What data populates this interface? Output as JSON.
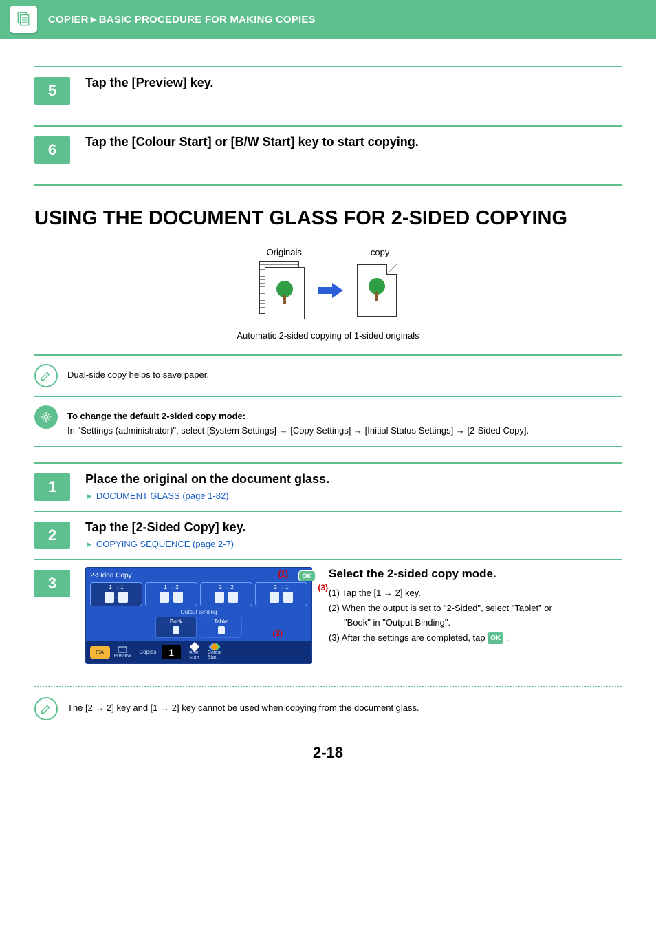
{
  "header": {
    "section": "COPIER",
    "sep": "►",
    "crumb": "BASIC PROCEDURE FOR MAKING COPIES"
  },
  "steps_a": {
    "five": {
      "num": "5",
      "title": "Tap the [Preview] key."
    },
    "six": {
      "num": "6",
      "title": "Tap the [Colour Start] or [B/W Start] key to start copying."
    }
  },
  "section_title": "USING THE DOCUMENT GLASS FOR 2-SIDED COPYING",
  "diagram": {
    "left_label": "Originals",
    "right_label": "copy",
    "caption": "Automatic 2-sided copying of 1-sided originals"
  },
  "note1": "Dual-side copy helps to save paper.",
  "note2": {
    "title": "To change the default 2-sided copy mode:",
    "body": "In \"Settings (administrator)\", select [System Settings] → [Copy Settings] → [Initial Status Settings] → [2-Sided Copy]."
  },
  "steps_b": {
    "one": {
      "num": "1",
      "title": "Place the original on the document glass.",
      "link": "DOCUMENT GLASS (page 1-82)"
    },
    "two": {
      "num": "2",
      "title": "Tap the [2-Sided Copy] key.",
      "link": "COPYING SEQUENCE (page 2-7)"
    },
    "three": {
      "num": "3"
    }
  },
  "panel": {
    "title": "2-Sided Copy",
    "opts": [
      "1 → 1",
      "1 → 2",
      "2 → 2",
      "2 → 1"
    ],
    "binding_label": "Output Binding",
    "bind": {
      "book": "Book",
      "tablet": "Tablet"
    },
    "ca": "CA",
    "preview": "Preview",
    "copies_label": "Copies",
    "copies_value": "1",
    "bw": "B/W",
    "start": "Start",
    "colour": "Colour",
    "ok": "OK",
    "callouts": {
      "c1": "(1)",
      "c2": "(2)",
      "c3": "(3)"
    }
  },
  "panel_desc": {
    "heading": "Select the 2-sided copy mode.",
    "l1": "(1) Tap the [1 → 2] key.",
    "l2": "(2) When the output is set to \"2-Sided\", select \"Tablet\" or",
    "l2b": "\"Book\" in \"Output Binding\".",
    "l3a": "(3) After the settings are completed, tap ",
    "l3b": " .",
    "ok": "OK"
  },
  "foot_note": "The [2 → 2] key and [1 → 2] key cannot be used when copying from the document glass.",
  "page_num": "2-18"
}
